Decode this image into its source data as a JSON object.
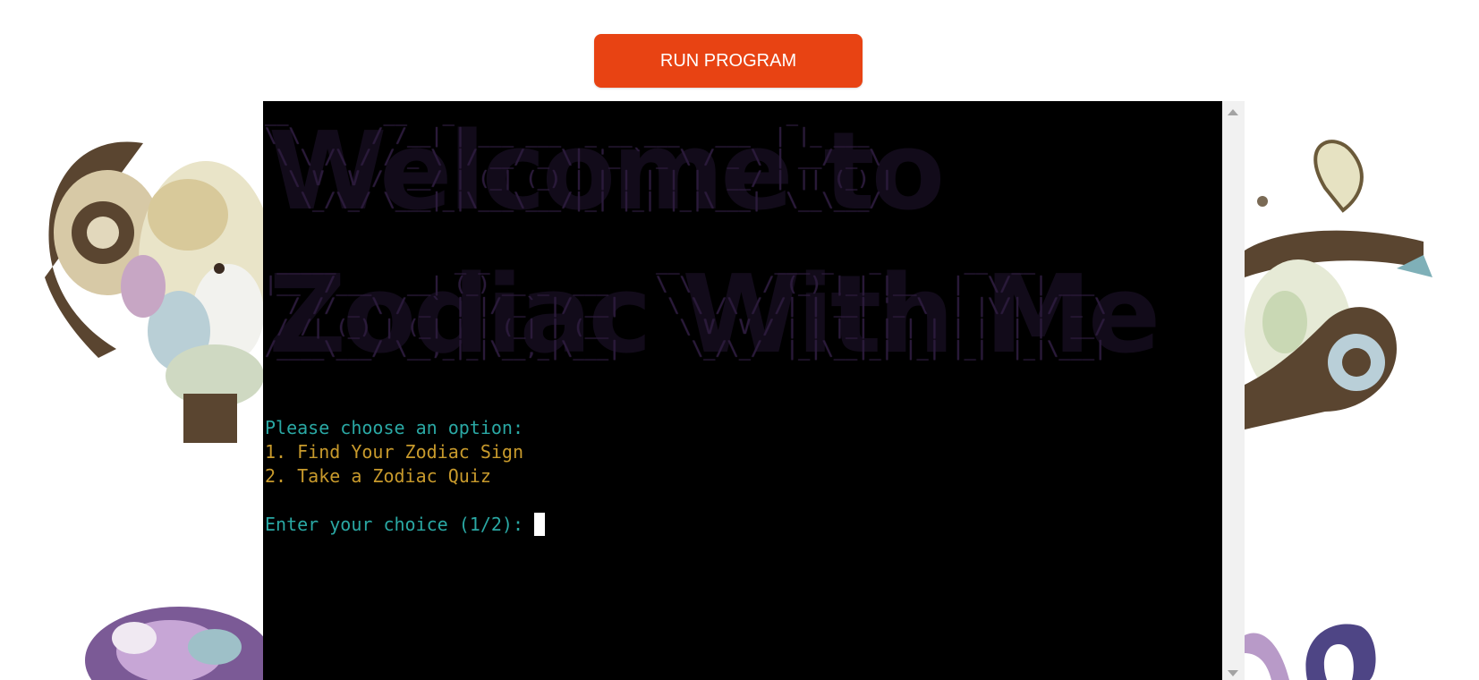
{
  "header": {
    "run_button_label": "RUN PROGRAM"
  },
  "terminal": {
    "ascii_welcome": "__        __   _                            _        \n\\ \\      / /__| | ___ ___  _ __ ___   ___  | |_ ___  \n \\ \\ /\\ / / _ \\ |/ __/ _ \\| '_ ` _ \\ / _ \\ | __/ _ \\ \n  \\ V  V /  __/ | (_| (_) | | | | | |  __/ | || (_) |\n   \\_/\\_/ \\___|_|\\___\\___/|_| |_| |_|\\___|  \\__\\___/ ",
    "ascii_title": " _____          _ _              __        ___ _   _       __  __      \n|__  /___   __| (_) __ _  ___    \\ \\      / (_) |_| |__   |  \\/  | ___ \n  / // _ \\ / _` | |/ _` |/ __|    \\ \\ /\\ / /| | __| '_ \\  | |\\/| |/ _ \\\n / /| (_) | (_| | | (_| | (__      \\ V  V / | | |_| | | | | |  | |  __/\n/____\\___/ \\__,_|_|\\__,_|\\___|      \\_/\\_/  |_|\\__|_| |_| |_|  |_|\\___|",
    "big_welcome": "Welcome to",
    "big_title": "Zodiac With Me",
    "prompt_heading": "Please choose an option:",
    "option_1": "1. Find Your Zodiac Sign",
    "option_2": "2. Take a Zodiac Quiz",
    "input_prompt": "Enter your choice (1/2): "
  },
  "colors": {
    "run_button": "#e84313",
    "terminal_bg": "#000000",
    "prompt_text": "#2aa8a4",
    "option_text": "#c89a2c"
  },
  "icons": {
    "aries": "ram-illustration",
    "cancer": "crab-illustration",
    "leo": "lion-illustration",
    "scroll_up": "arrow-up-icon",
    "scroll_down": "arrow-down-icon"
  }
}
